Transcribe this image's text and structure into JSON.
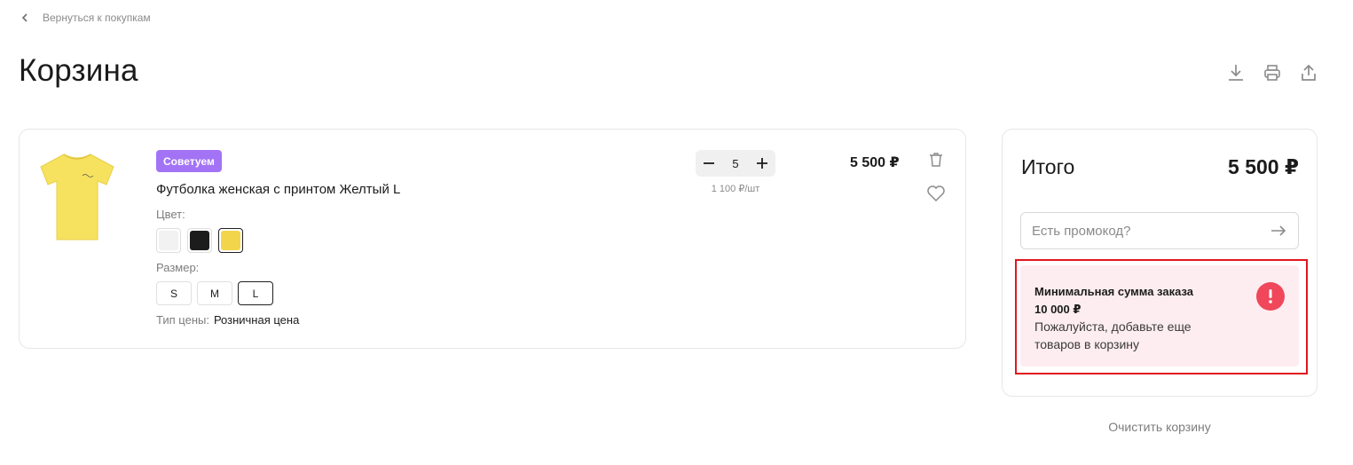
{
  "nav": {
    "back_label": "Вернуться к покупкам"
  },
  "page": {
    "title": "Корзина"
  },
  "toolbar": {
    "icons": [
      "download-icon",
      "print-icon",
      "share-icon"
    ]
  },
  "cart_item": {
    "badge": "Советуем",
    "name": "Футболка женская с принтом Желтый L",
    "color_label": "Цвет:",
    "colors": [
      {
        "name": "white",
        "hex": "#f2f2f2",
        "selected": false
      },
      {
        "name": "black",
        "hex": "#1c1c1c",
        "selected": false
      },
      {
        "name": "yellow",
        "hex": "#f2d54a",
        "selected": true
      }
    ],
    "size_label": "Размер:",
    "sizes": [
      {
        "label": "S",
        "selected": false
      },
      {
        "label": "M",
        "selected": false
      },
      {
        "label": "L",
        "selected": true
      }
    ],
    "price_type_label": "Тип цены:",
    "price_type_value": "Розничная цена",
    "quantity": "5",
    "unit_price": "1 100 ₽/шт",
    "line_total": "5 500 ₽",
    "product_color": "#f6e25f"
  },
  "summary": {
    "title": "Итого",
    "total": "5 500 ₽",
    "promo_placeholder": "Есть промокод?",
    "warning": {
      "title_line1": "Минимальная сумма заказа",
      "title_line2": "10 000 ₽",
      "text": "Пожалуйста, добавьте еще товаров в корзину"
    }
  },
  "clear_cart_label": "Очистить корзину",
  "colors": {
    "badge": "#a373f5",
    "warning_bg": "#fdedf0",
    "alert": "#f0475a",
    "highlight": "#e0171f"
  }
}
